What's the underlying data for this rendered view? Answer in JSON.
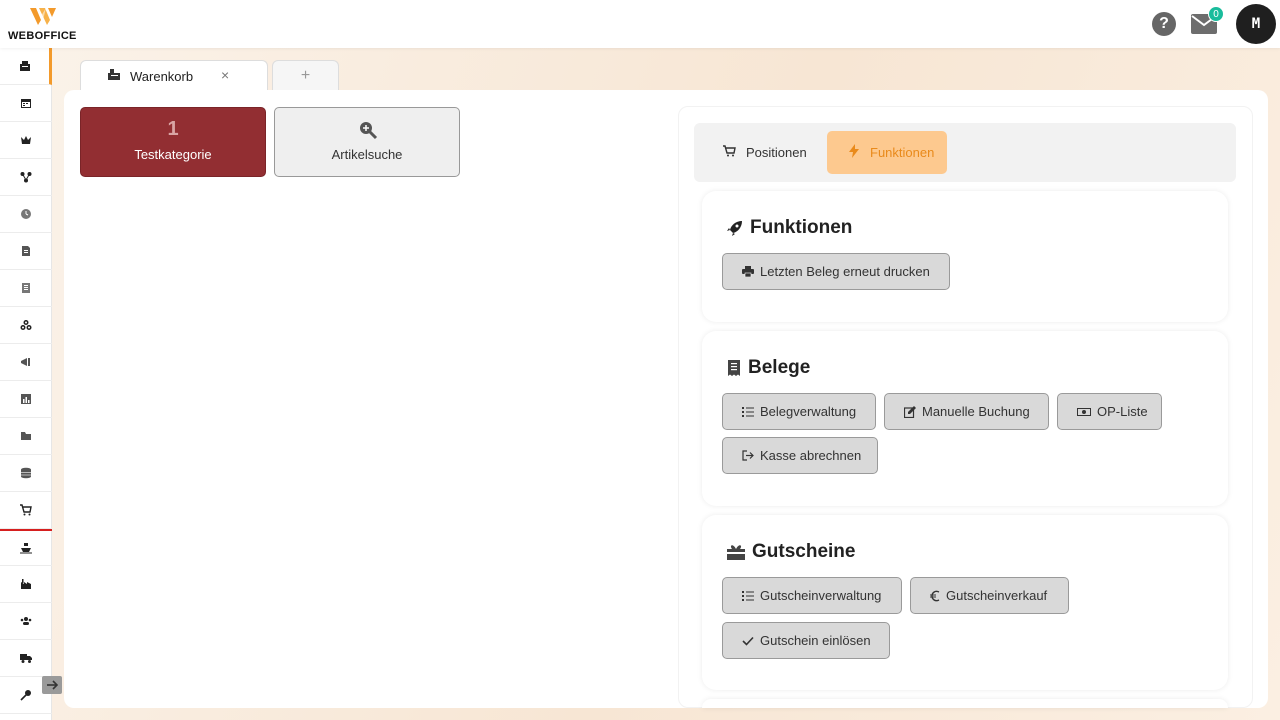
{
  "brand": {
    "name": "WEBOFFICE",
    "accent": "#f39a2b"
  },
  "header": {
    "help_label": "?",
    "mail_count": "0",
    "avatar_initial": "M"
  },
  "sidebar": {
    "items": [
      {
        "icon": "cash-register-icon"
      },
      {
        "icon": "calendar-icon"
      },
      {
        "icon": "crown-icon"
      },
      {
        "icon": "network-icon"
      },
      {
        "icon": "clock-icon"
      },
      {
        "icon": "document-icon"
      },
      {
        "icon": "receipt-icon"
      },
      {
        "icon": "boxes-icon"
      },
      {
        "icon": "megaphone-icon"
      },
      {
        "icon": "chart-icon"
      },
      {
        "icon": "folder-icon"
      },
      {
        "icon": "database-icon"
      },
      {
        "icon": "cart-icon"
      },
      {
        "icon": "ship-icon"
      },
      {
        "icon": "industry-icon"
      },
      {
        "icon": "users-icon"
      },
      {
        "icon": "truck-icon"
      },
      {
        "icon": "key-icon"
      }
    ]
  },
  "tabs": [
    {
      "label": "Warenkorb",
      "icon": "cash-register-icon",
      "close": "×"
    },
    {
      "label": "+"
    }
  ],
  "categories": [
    {
      "number": "1",
      "label": "Testkategorie",
      "color": "#922e32"
    },
    {
      "label": "Artikelsuche",
      "icon": "search-plus-icon"
    }
  ],
  "toggle": {
    "positions_label": "Positionen",
    "functions_label": "Funktionen"
  },
  "sections": {
    "funktionen": {
      "title": "Funktionen",
      "buttons": [
        "Letzten Beleg erneut drucken"
      ]
    },
    "belege": {
      "title": "Belege",
      "buttons": [
        "Belegverwaltung",
        "Manuelle Buchung",
        "OP-Liste",
        "Kasse abrechnen"
      ]
    },
    "gutscheine": {
      "title": "Gutscheine",
      "buttons": [
        "Gutscheinverwaltung",
        "Gutscheinverkauf",
        "Gutschein einlösen"
      ]
    }
  }
}
